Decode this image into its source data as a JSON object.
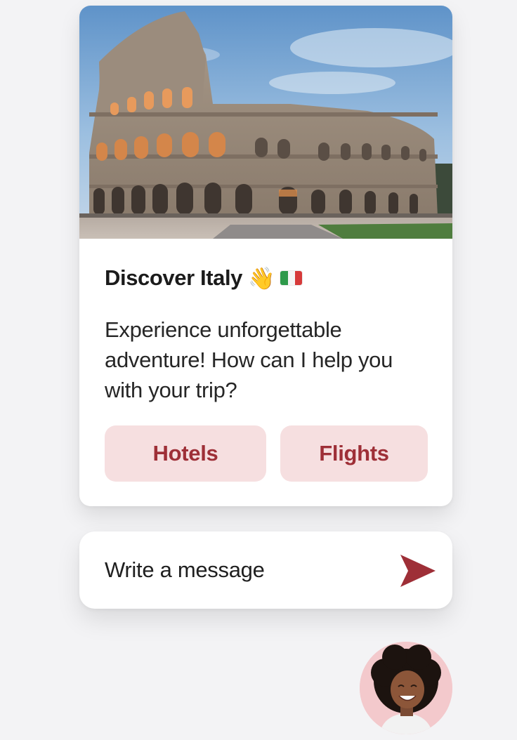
{
  "card": {
    "image_alt": "Colosseum in Rome",
    "title": "Discover Italy",
    "title_emoji": "👋",
    "body": "Experience unforgettable adventure! How can I help you with your trip?",
    "quick_replies": [
      "Hotels",
      "Flights"
    ]
  },
  "composer": {
    "placeholder": "Write a message",
    "value": ""
  },
  "icons": {
    "wave": "waving-hand-icon",
    "flag": "italy-flag-icon",
    "send": "send-icon",
    "avatar": "agent-avatar"
  },
  "colors": {
    "accent": "#9e2f37",
    "chip_bg": "#f6dfe0",
    "avatar_bg": "#f3c9cc",
    "page_bg": "#f3f3f5"
  }
}
